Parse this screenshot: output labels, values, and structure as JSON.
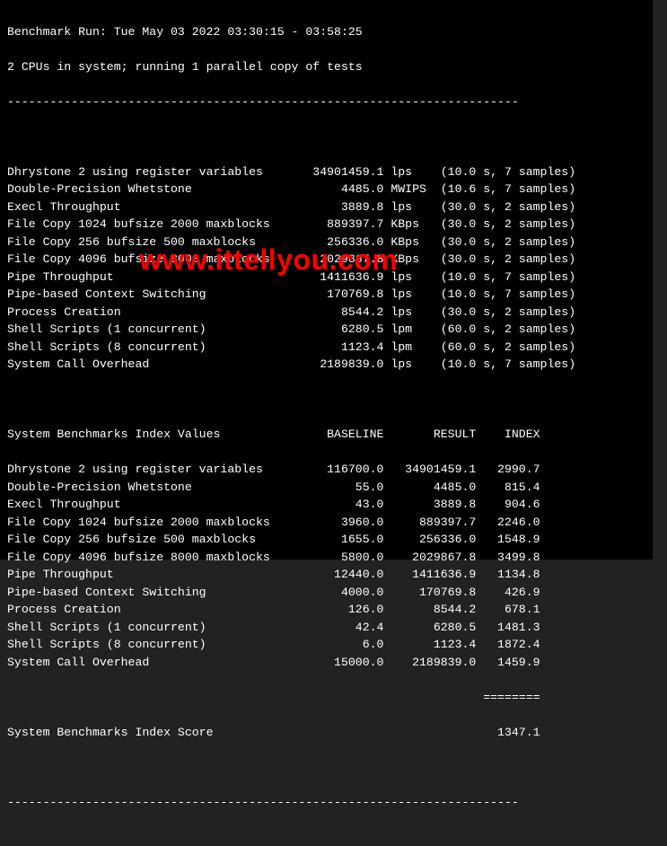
{
  "watermark": "www.ittellyou.com",
  "header": {
    "run_line": "Benchmark Run: Tue May 03 2022 03:30:15 - 03:58:25",
    "cpu_line": "2 CPUs in system; running 1 parallel copy of tests"
  },
  "first_divider": "------------------------------------------------------------------------",
  "results": {
    "rows": [
      {
        "name": "Dhrystone 2 using register variables",
        "value": "34901459.1",
        "unit": "lps",
        "timing": "(10.0 s, 7 samples)"
      },
      {
        "name": "Double-Precision Whetstone",
        "value": "4485.0",
        "unit": "MWIPS",
        "timing": "(10.6 s, 7 samples)"
      },
      {
        "name": "Execl Throughput",
        "value": "3889.8",
        "unit": "lps",
        "timing": "(30.0 s, 2 samples)"
      },
      {
        "name": "File Copy 1024 bufsize 2000 maxblocks",
        "value": "889397.7",
        "unit": "KBps",
        "timing": "(30.0 s, 2 samples)"
      },
      {
        "name": "File Copy 256 bufsize 500 maxblocks",
        "value": "256336.0",
        "unit": "KBps",
        "timing": "(30.0 s, 2 samples)"
      },
      {
        "name": "File Copy 4096 bufsize 8000 maxblocks",
        "value": "2029867.8",
        "unit": "KBps",
        "timing": "(30.0 s, 2 samples)"
      },
      {
        "name": "Pipe Throughput",
        "value": "1411636.9",
        "unit": "lps",
        "timing": "(10.0 s, 7 samples)"
      },
      {
        "name": "Pipe-based Context Switching",
        "value": "170769.8",
        "unit": "lps",
        "timing": "(10.0 s, 7 samples)"
      },
      {
        "name": "Process Creation",
        "value": "8544.2",
        "unit": "lps",
        "timing": "(30.0 s, 2 samples)"
      },
      {
        "name": "Shell Scripts (1 concurrent)",
        "value": "6280.5",
        "unit": "lpm",
        "timing": "(60.0 s, 2 samples)"
      },
      {
        "name": "Shell Scripts (8 concurrent)",
        "value": "1123.4",
        "unit": "lpm",
        "timing": "(60.0 s, 2 samples)"
      },
      {
        "name": "System Call Overhead",
        "value": "2189839.0",
        "unit": "lps",
        "timing": "(10.0 s, 7 samples)"
      }
    ]
  },
  "index": {
    "header": {
      "title": "System Benchmarks Index Values",
      "baseline": "BASELINE",
      "result": "RESULT",
      "index": "INDEX"
    },
    "rows": [
      {
        "name": "Dhrystone 2 using register variables",
        "baseline": "116700.0",
        "result": "34901459.1",
        "index": "2990.7"
      },
      {
        "name": "Double-Precision Whetstone",
        "baseline": "55.0",
        "result": "4485.0",
        "index": "815.4"
      },
      {
        "name": "Execl Throughput",
        "baseline": "43.0",
        "result": "3889.8",
        "index": "904.6"
      },
      {
        "name": "File Copy 1024 bufsize 2000 maxblocks",
        "baseline": "3960.0",
        "result": "889397.7",
        "index": "2246.0"
      },
      {
        "name": "File Copy 256 bufsize 500 maxblocks",
        "baseline": "1655.0",
        "result": "256336.0",
        "index": "1548.9"
      },
      {
        "name": "File Copy 4096 bufsize 8000 maxblocks",
        "baseline": "5800.0",
        "result": "2029867.8",
        "index": "3499.8"
      },
      {
        "name": "Pipe Throughput",
        "baseline": "12440.0",
        "result": "1411636.9",
        "index": "1134.8"
      },
      {
        "name": "Pipe-based Context Switching",
        "baseline": "4000.0",
        "result": "170769.8",
        "index": "426.9"
      },
      {
        "name": "Process Creation",
        "baseline": "126.0",
        "result": "8544.2",
        "index": "678.1"
      },
      {
        "name": "Shell Scripts (1 concurrent)",
        "baseline": "42.4",
        "result": "6280.5",
        "index": "1481.3"
      },
      {
        "name": "Shell Scripts (8 concurrent)",
        "baseline": "6.0",
        "result": "1123.4",
        "index": "1872.4"
      },
      {
        "name": "System Call Overhead",
        "baseline": "15000.0",
        "result": "2189839.0",
        "index": "1459.9"
      }
    ]
  },
  "index_divider": "                                                                   ========",
  "score": {
    "label": "System Benchmarks Index Score",
    "value": "1347.1"
  },
  "bottom_divider": "------------------------------------------------------------------------"
}
